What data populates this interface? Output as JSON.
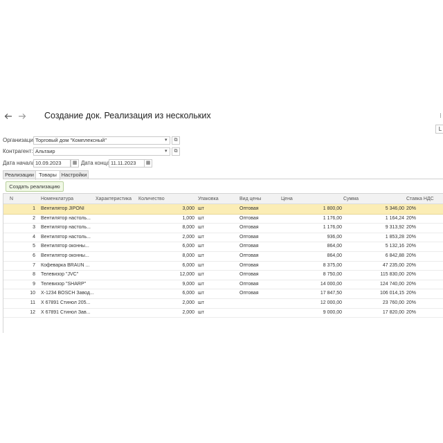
{
  "window": {
    "back_icon": "arrow-left-icon",
    "forward_icon": "arrow-right-icon",
    "title": "Создание док. Реализация из нескольких",
    "edge_top": "⁝",
    "edge_button": "L"
  },
  "form": {
    "organization_label": "Организация:",
    "organization_value": "Торговый дом \"Комплексный\"",
    "counterparty_label": "Контрагент:",
    "counterparty_value": "Альтаир",
    "date_start_label": "Дата начала:",
    "date_start_value": "10.09.2023",
    "date_end_label": "Дата конца:",
    "date_end_value": "11.11.2023",
    "dropdown_glyph": "▾",
    "open_glyph": "⧉",
    "calendar_glyph": "▦"
  },
  "tabs": [
    {
      "label": "Реализации"
    },
    {
      "label": "Товары"
    },
    {
      "label": "Настройки"
    }
  ],
  "create_button": "Создать реализацию",
  "table": {
    "columns": [
      "N",
      "Номенклатура",
      "Характеристика",
      "Количество",
      "Упаковка",
      "Вид цены",
      "Цена",
      "Сумма",
      "Ставка НДС"
    ],
    "rows": [
      {
        "n": "1",
        "item": "Вентилятор JIPONI",
        "char": "",
        "qty": "3,000",
        "pack": "шт",
        "price_type": "Оптовая",
        "price": "1 800,00",
        "sum": "5 346,00",
        "vat": "20%"
      },
      {
        "n": "2",
        "item": "Вентилятор настоль...",
        "char": "",
        "qty": "1,000",
        "pack": "шт",
        "price_type": "Оптовая",
        "price": "1 176,00",
        "sum": "1 164,24",
        "vat": "20%"
      },
      {
        "n": "3",
        "item": "Вентилятор настоль...",
        "char": "",
        "qty": "8,000",
        "pack": "шт",
        "price_type": "Оптовая",
        "price": "1 176,00",
        "sum": "9 313,92",
        "vat": "20%"
      },
      {
        "n": "4",
        "item": "Вентилятор настоль...",
        "char": "",
        "qty": "2,000",
        "pack": "шт",
        "price_type": "Оптовая",
        "price": "936,00",
        "sum": "1 853,28",
        "vat": "20%"
      },
      {
        "n": "5",
        "item": "Вентилятор оконны...",
        "char": "",
        "qty": "6,000",
        "pack": "шт",
        "price_type": "Оптовая",
        "price": "864,00",
        "sum": "5 132,16",
        "vat": "20%"
      },
      {
        "n": "6",
        "item": "Вентилятор оконны...",
        "char": "",
        "qty": "8,000",
        "pack": "шт",
        "price_type": "Оптовая",
        "price": "864,00",
        "sum": "6 842,88",
        "vat": "20%"
      },
      {
        "n": "7",
        "item": "Кофеварка BRAUN ...",
        "char": "",
        "qty": "6,000",
        "pack": "шт",
        "price_type": "Оптовая",
        "price": "8 375,00",
        "sum": "47 235,00",
        "vat": "20%"
      },
      {
        "n": "8",
        "item": "Телевизор \"JVC\"",
        "char": "",
        "qty": "12,000",
        "pack": "шт",
        "price_type": "Оптовая",
        "price": "8 750,00",
        "sum": "115 830,00",
        "vat": "20%"
      },
      {
        "n": "9",
        "item": "Телевизор \"SHARP\"",
        "char": "",
        "qty": "9,000",
        "pack": "шт",
        "price_type": "Оптовая",
        "price": "14 000,00",
        "sum": "124 740,00",
        "vat": "20%"
      },
      {
        "n": "10",
        "item": "X-1234 BOSCH Завод...",
        "char": "",
        "qty": "6,000",
        "pack": "шт",
        "price_type": "Оптовая",
        "price": "17 847,50",
        "sum": "106 014,15",
        "vat": "20%"
      },
      {
        "n": "11",
        "item": "X 67891 Стинол 205...",
        "char": "",
        "qty": "2,000",
        "pack": "шт",
        "price_type": "",
        "price": "12 000,00",
        "sum": "23 760,00",
        "vat": "20%"
      },
      {
        "n": "12",
        "item": "X 67891 Стинол Зав...",
        "char": "",
        "qty": "2,000",
        "pack": "шт",
        "price_type": "",
        "price": "9 000,00",
        "sum": "17 820,00",
        "vat": "20%"
      }
    ]
  },
  "colors": {
    "selected_row": "#fbedb5",
    "button_bg": "#f1f8e6",
    "button_border": "#b7cf9b"
  }
}
